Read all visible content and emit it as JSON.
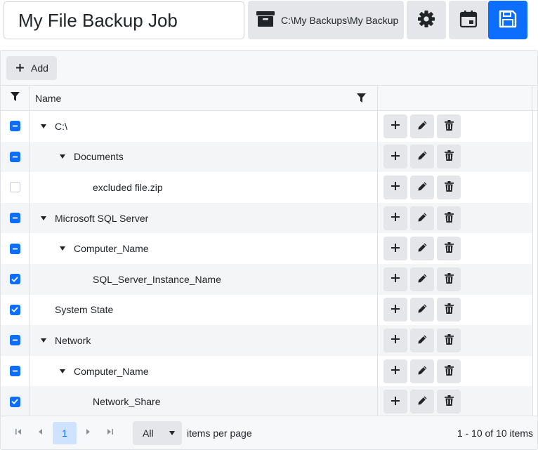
{
  "job": {
    "name": "My File Backup Job"
  },
  "destination": {
    "path": "C:\\My Backups\\My Backup",
    "icon": "archive-icon"
  },
  "toolbar": {
    "add_label": "Add"
  },
  "columns": {
    "name": "Name"
  },
  "rows": [
    {
      "label": "C:\\",
      "level": 0,
      "expandable": true,
      "check": "partial"
    },
    {
      "label": "Documents",
      "level": 1,
      "expandable": true,
      "check": "partial"
    },
    {
      "label": "excluded file.zip",
      "level": 2,
      "expandable": false,
      "check": "none"
    },
    {
      "label": "Microsoft SQL Server",
      "level": 0,
      "expandable": true,
      "check": "partial"
    },
    {
      "label": "Computer_Name",
      "level": 1,
      "expandable": true,
      "check": "partial"
    },
    {
      "label": "SQL_Server_Instance_Name",
      "level": 2,
      "expandable": false,
      "check": "checked"
    },
    {
      "label": "System State",
      "level": 0,
      "expandable": false,
      "check": "checked"
    },
    {
      "label": "Network",
      "level": 0,
      "expandable": true,
      "check": "partial"
    },
    {
      "label": "Computer_Name",
      "level": 1,
      "expandable": true,
      "check": "partial"
    },
    {
      "label": "Network_Share",
      "level": 2,
      "expandable": false,
      "check": "checked"
    }
  ],
  "pager": {
    "current_page": "1",
    "page_size": "All",
    "items_per_page_label": "items per page",
    "info": "1 - 10 of 10 items"
  },
  "colors": {
    "accent": "#0d6efd",
    "button_bg": "#e4e6e9",
    "header_bg": "#f7f8f9"
  }
}
